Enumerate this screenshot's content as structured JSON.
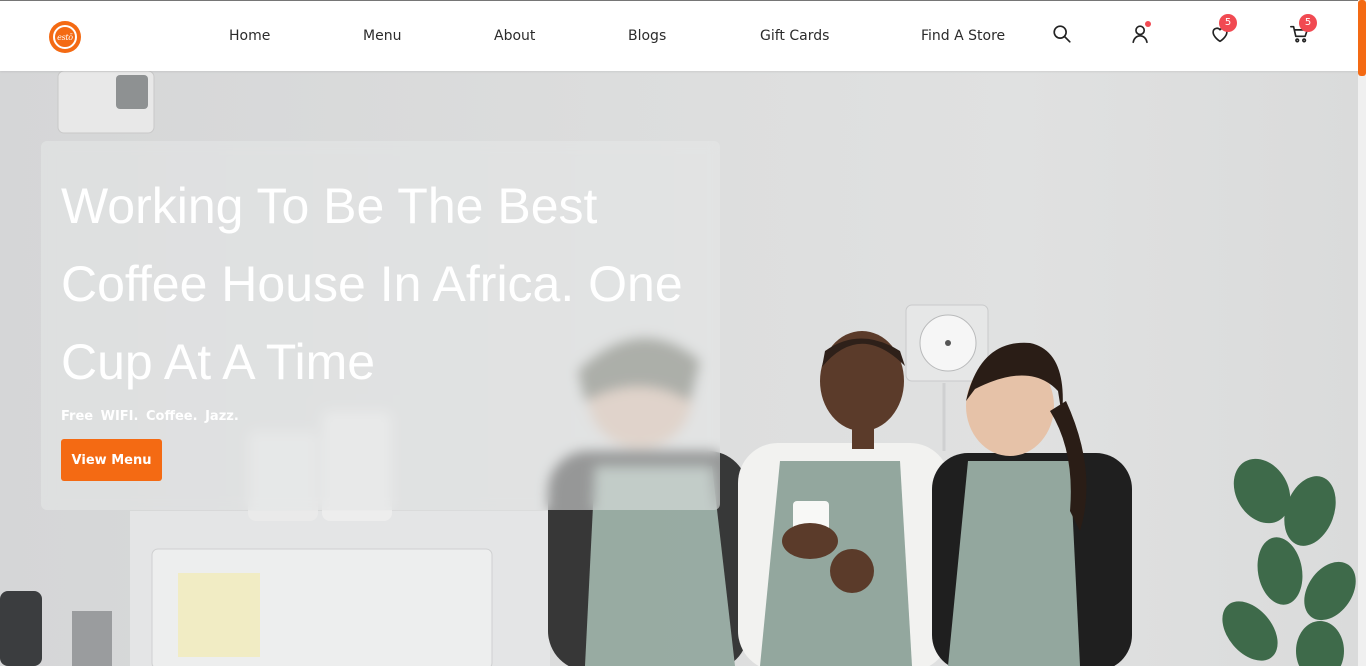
{
  "brand": {
    "logo_text": "estō"
  },
  "nav": {
    "items": [
      {
        "label": "Home"
      },
      {
        "label": "Menu"
      },
      {
        "label": "About"
      },
      {
        "label": "Blogs"
      },
      {
        "label": "Gift Cards"
      },
      {
        "label": "Find A Store"
      }
    ],
    "icons": {
      "search": "search-icon",
      "account": "user-icon",
      "wishlist": "heart-icon",
      "cart": "cart-icon"
    },
    "wishlist_count": "5",
    "cart_count": "5"
  },
  "hero": {
    "headline": "Working To Be The Best Coffee House In Africa. One Cup At A Time",
    "tagline": "Free WIFI.  Coffee.  Jazz.",
    "cta_label": "View Menu"
  },
  "colors": {
    "accent": "#f46a13",
    "badge": "#f14a52",
    "apron": "#93a79e"
  }
}
